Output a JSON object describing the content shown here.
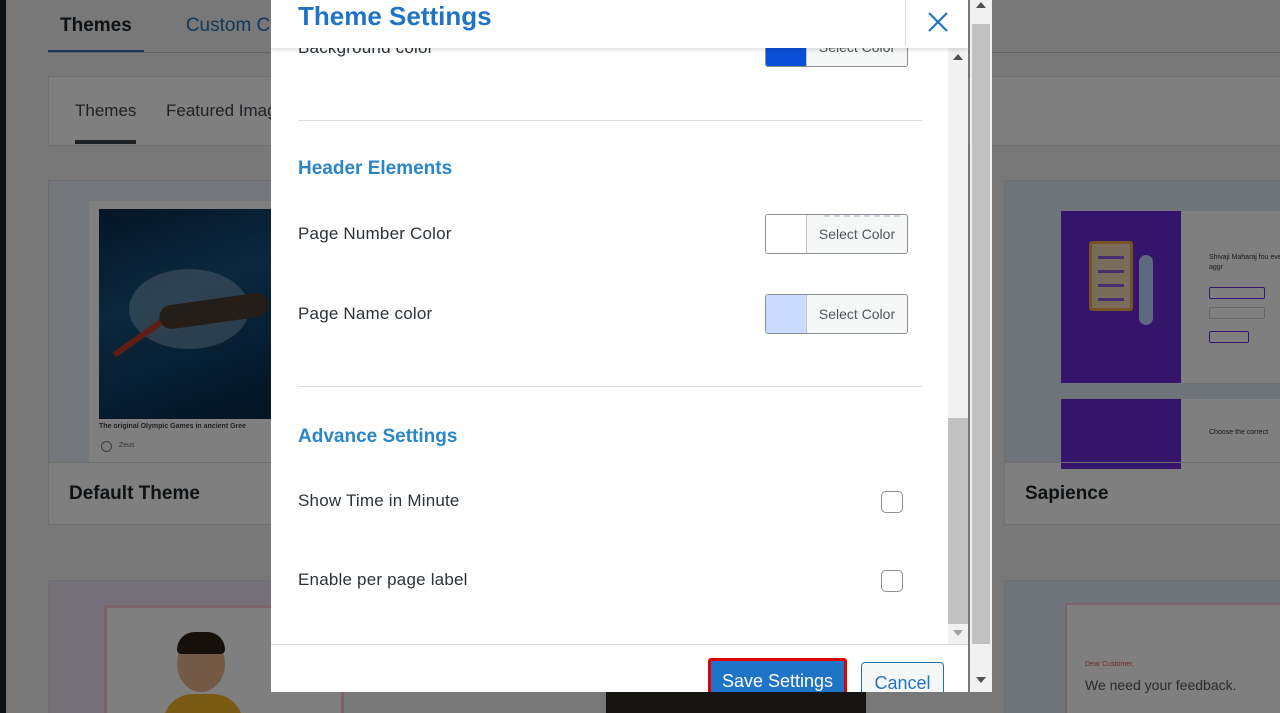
{
  "background": {
    "top_tabs": [
      {
        "label": "Themes",
        "active": true
      },
      {
        "label": "Custom CSS",
        "active": false
      }
    ],
    "sub_tabs": [
      {
        "label": "Themes",
        "active": true
      },
      {
        "label": "Featured Imag",
        "active": false
      }
    ],
    "cards": {
      "default_theme": {
        "title": "Default Theme",
        "preview_caption": "The original Olympic Games in ancient Gree",
        "preview_option": "Zeus"
      },
      "sapience": {
        "title": "Sapience",
        "preview_text": "Shivaji Maharaj fou every kind of aggr",
        "preview_text_2": "Choose the correct"
      },
      "bottom_right": {
        "small_text": "Dear Customer,",
        "big_text": "We need your feedback."
      }
    }
  },
  "modal": {
    "title": "Theme Settings",
    "close_label": "×",
    "partial_row": {
      "label": "Background color",
      "button_label": "Select Color",
      "swatch_color": "#0b4fd6"
    },
    "sections": {
      "header_elements": {
        "title": "Header Elements",
        "rows": [
          {
            "label": "Page Number Color",
            "button_label": "Select Color",
            "swatch_color": "#ffffff"
          },
          {
            "label": "Page Name color",
            "button_label": "Select Color",
            "swatch_color": "#c9dcff"
          }
        ]
      },
      "advance_settings": {
        "title": "Advance Settings",
        "rows": [
          {
            "label": "Show Time in Minute",
            "checked": false
          },
          {
            "label": "Enable per page label",
            "checked": false
          }
        ]
      }
    },
    "footer": {
      "save_label": "Save Settings",
      "cancel_label": "Cancel"
    }
  },
  "colors": {
    "accent": "#1f74c7",
    "section_title": "#2a86c8",
    "highlight_border": "#e00000"
  }
}
